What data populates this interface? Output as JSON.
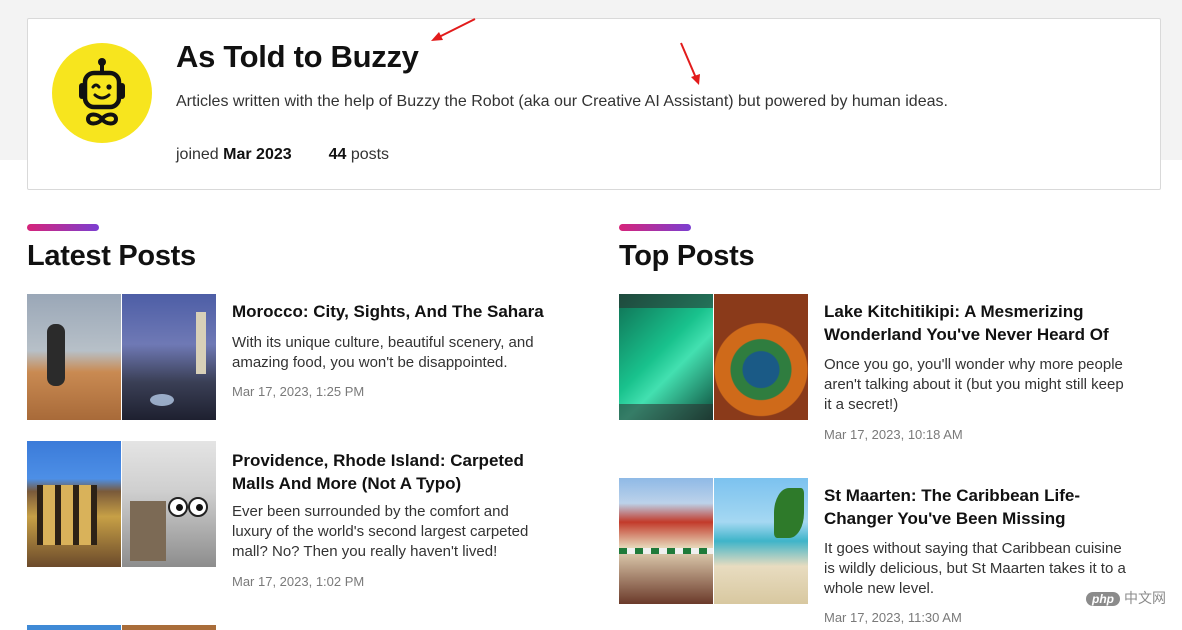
{
  "profile": {
    "name": "As Told to Buzzy",
    "description": "Articles written with the help of Buzzy the Robot (aka our Creative AI Assistant) but powered by human ideas.",
    "joined_label": "joined",
    "joined_date": "Mar 2023",
    "post_count": "44",
    "posts_label": "posts",
    "avatar_color": "#f7e51e"
  },
  "sections": {
    "latest_title": "Latest Posts",
    "top_title": "Top Posts",
    "accent_gradient": [
      "#d6247a",
      "#7b3fd1"
    ]
  },
  "latest_posts": [
    {
      "title_line1": "Morocco: City, Sights, And The Sahara",
      "title_line2": "",
      "excerpt_line1": "With its unique culture, beautiful scenery, and",
      "excerpt_line2": "amazing food, you won't be disappointed.",
      "excerpt_line3": "",
      "date": "Mar 17, 2023, 1:25 PM"
    },
    {
      "title_line1": "Providence, Rhode Island: Carpeted",
      "title_line2": "Malls And More (Not A Typo)",
      "excerpt_line1": "Ever been surrounded by the comfort and",
      "excerpt_line2": "luxury of the world's second largest carpeted",
      "excerpt_line3": "mall? No? Then you really haven't lived!",
      "date": "Mar 17, 2023, 1:02 PM"
    }
  ],
  "top_posts": [
    {
      "title_line1": "Lake Kitchitikipi: A Mesmerizing",
      "title_line2": "Wonderland You've Never Heard Of",
      "excerpt_line1": "Once you go, you'll wonder why more people",
      "excerpt_line2": "aren't talking about it (but you might still keep",
      "excerpt_line3": "it a secret!)",
      "date": "Mar 17, 2023, 10:18 AM"
    },
    {
      "title_line1": "St Maarten: The Caribbean Life-",
      "title_line2": "Changer You've Been Missing",
      "excerpt_line1": "It goes without saying that Caribbean cuisine",
      "excerpt_line2": "is wildly delicious, but St Maarten takes it to a",
      "excerpt_line3": "whole new level.",
      "date": "Mar 17, 2023, 11:30 AM"
    }
  ],
  "watermark": {
    "badge": "php",
    "text": "中文网"
  }
}
